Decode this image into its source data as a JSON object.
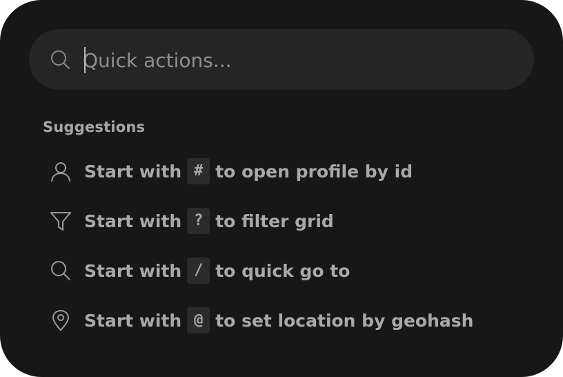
{
  "search": {
    "placeholder": "Quick actions..."
  },
  "suggestions": {
    "heading": "Suggestions",
    "items": [
      {
        "icon": "user-icon",
        "prefix": "Start with",
        "key": "#",
        "suffix": "to open profile by id"
      },
      {
        "icon": "filter-icon",
        "prefix": "Start with",
        "key": "?",
        "suffix": "to filter grid"
      },
      {
        "icon": "search-icon",
        "prefix": "Start with",
        "key": "/",
        "suffix": "to quick go to"
      },
      {
        "icon": "map-pin-icon",
        "prefix": "Start with",
        "key": "@",
        "suffix": "to set location by geohash"
      }
    ]
  },
  "colors": {
    "background": "#171717",
    "search_bar": "#252525",
    "text": "#a9a9a9",
    "key_bg": "#2b2b2b"
  }
}
